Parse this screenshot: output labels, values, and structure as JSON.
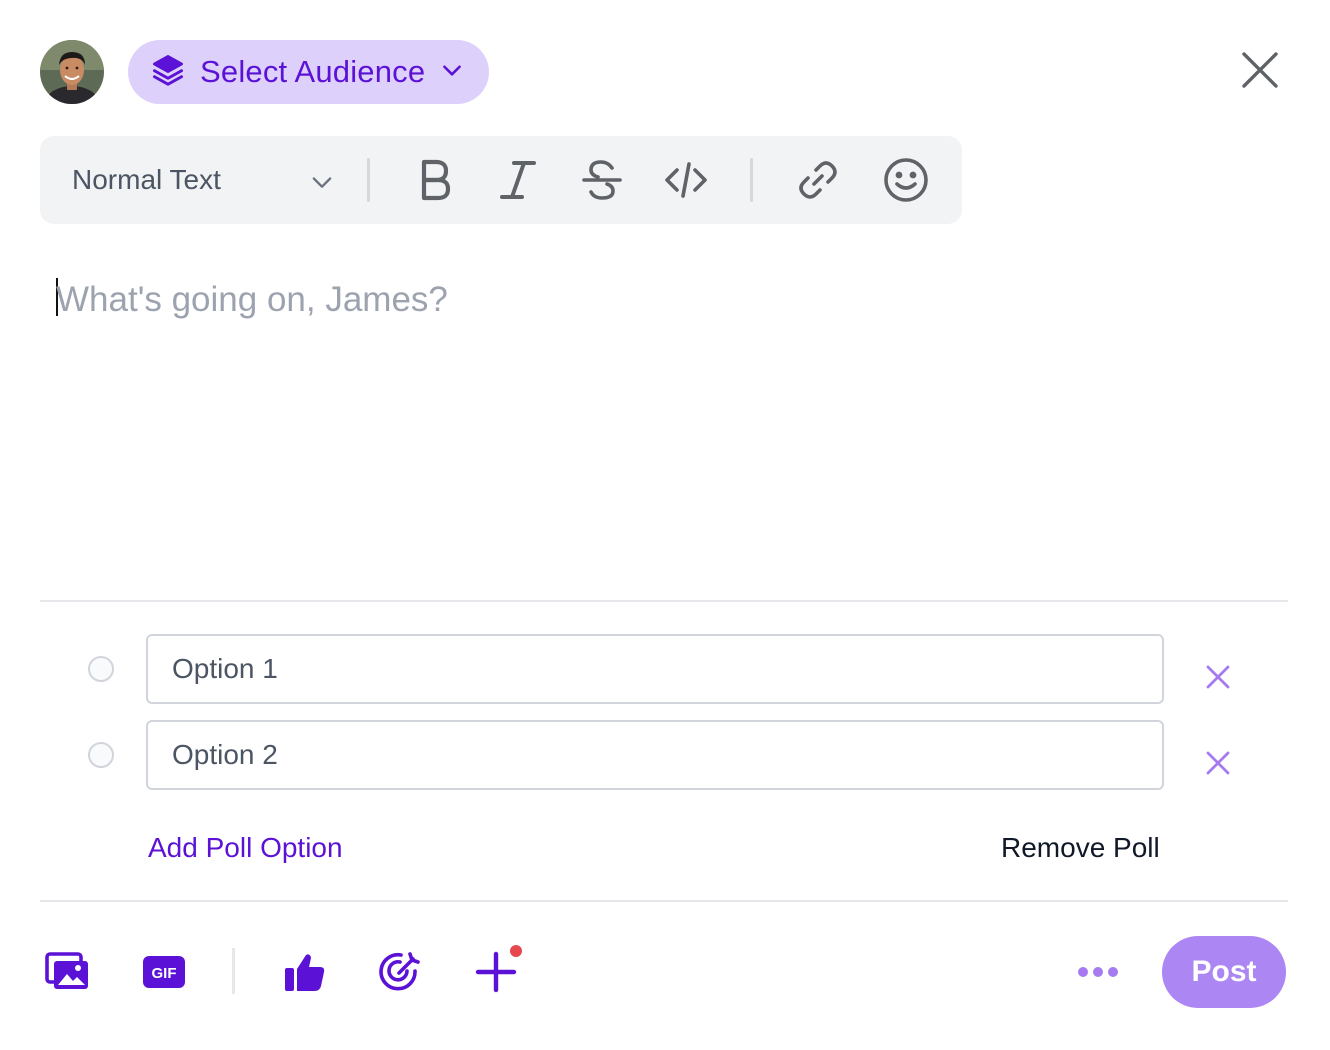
{
  "header": {
    "avatar_alt": "James",
    "audience_label": "Select Audience"
  },
  "toolbar": {
    "text_style": "Normal Text",
    "buttons": [
      "bold-icon",
      "italic-icon",
      "strikethrough-icon",
      "code-icon",
      "link-icon",
      "emoji-icon"
    ]
  },
  "editor": {
    "placeholder": "What's going on, James?"
  },
  "poll": {
    "options": [
      {
        "placeholder": "Option 1",
        "value": ""
      },
      {
        "placeholder": "Option 2",
        "value": ""
      }
    ],
    "add_option_label": "Add Poll Option",
    "remove_poll_label": "Remove Poll"
  },
  "footer": {
    "icons": [
      "gallery-icon",
      "gif-icon",
      "thumbs-up-icon",
      "target-icon",
      "plus-icon"
    ],
    "more_icon": "more-dots-icon",
    "post_label": "Post"
  },
  "colors": {
    "accent": "#5b12d6",
    "audience_bg": "#ddd0fa",
    "post_bg": "#ac86f3",
    "remove_x": "#a67bef",
    "badge": "#e5484d"
  }
}
